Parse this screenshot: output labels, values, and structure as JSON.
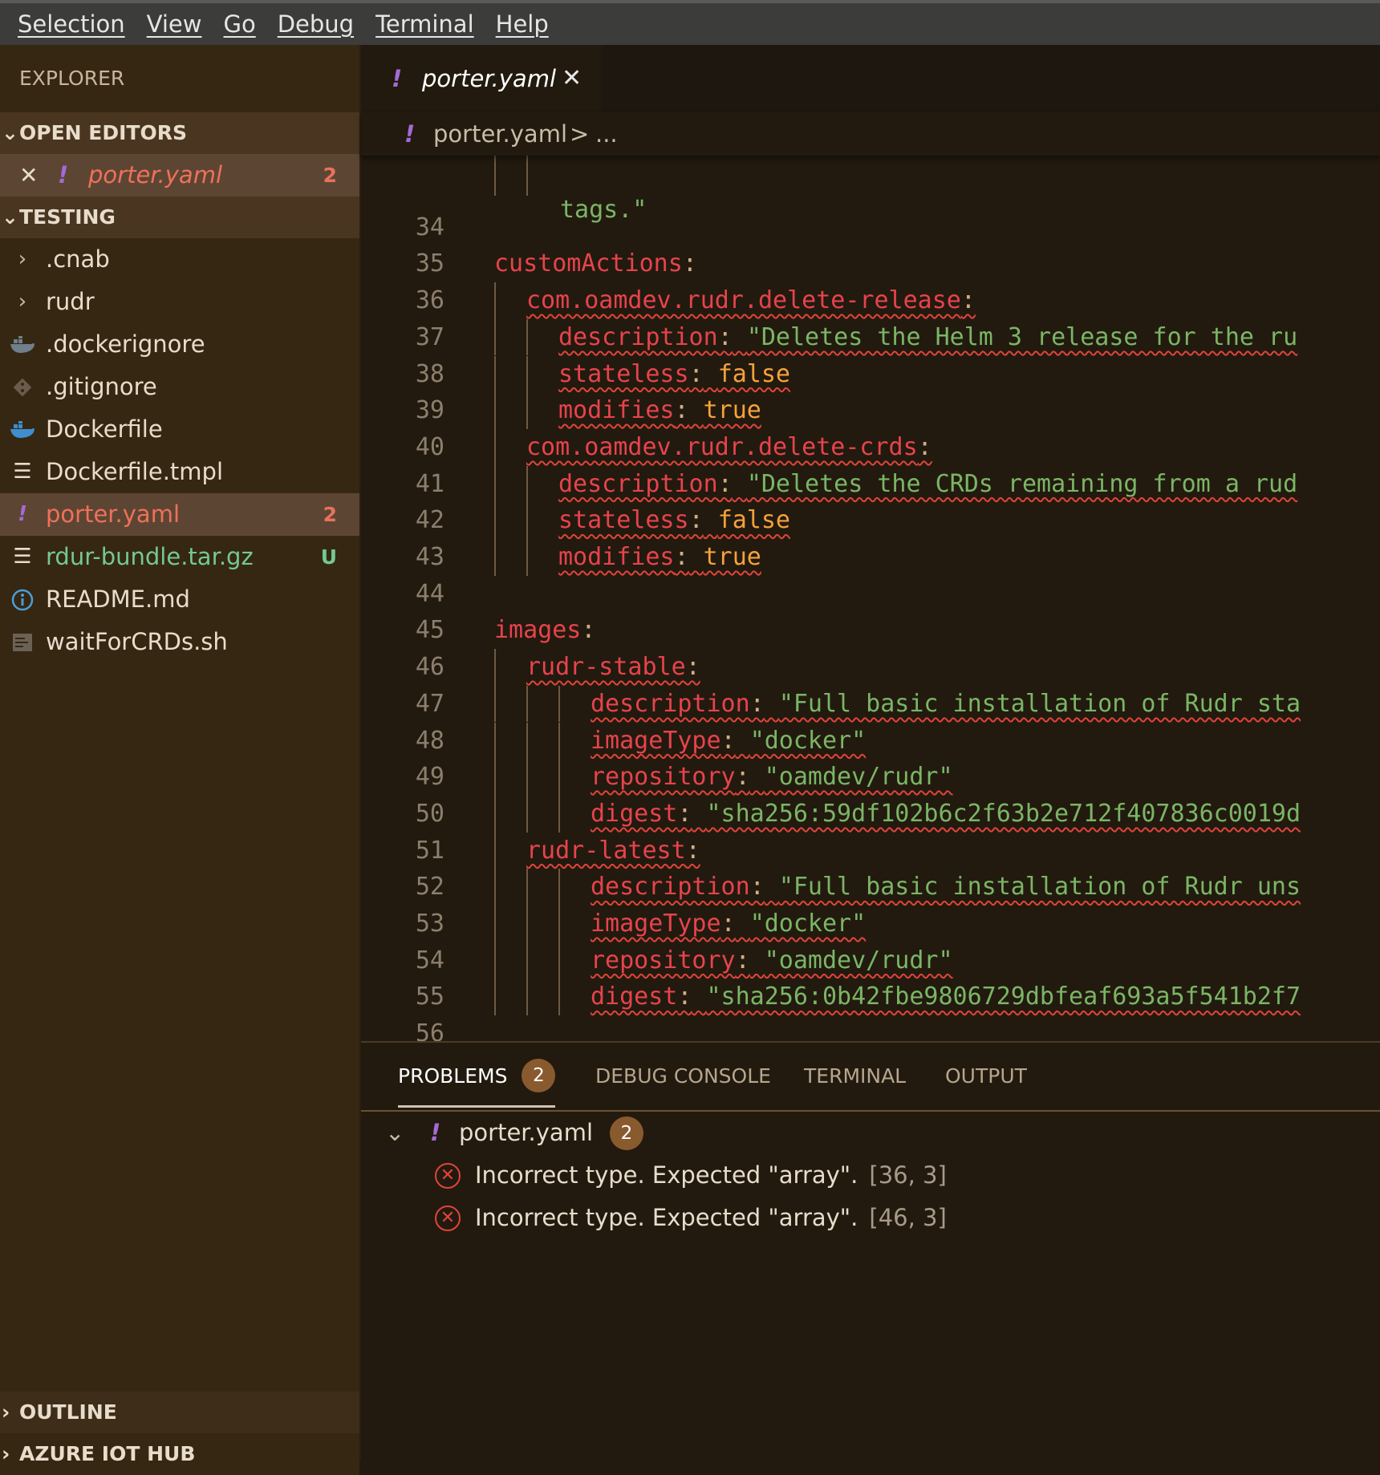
{
  "menu": [
    "Selection",
    "View",
    "Go",
    "Debug",
    "Terminal",
    "Help"
  ],
  "sidebar": {
    "title": "EXPLORER",
    "open_editors": {
      "header": "OPEN EDITORS",
      "items": [
        {
          "name": "porter.yaml",
          "badge": "2"
        }
      ]
    },
    "folder": {
      "header": "TESTING",
      "items": [
        {
          "name": ".cnab",
          "icon": "chevron-right-icon",
          "badge": ""
        },
        {
          "name": "rudr",
          "icon": "chevron-right-icon",
          "badge": ""
        },
        {
          "name": ".dockerignore",
          "icon": "docker-icon",
          "badge": ""
        },
        {
          "name": ".gitignore",
          "icon": "git-icon",
          "badge": ""
        },
        {
          "name": "Dockerfile",
          "icon": "docker-icon",
          "badge": ""
        },
        {
          "name": "Dockerfile.tmpl",
          "icon": "lines-icon",
          "badge": ""
        },
        {
          "name": "porter.yaml",
          "icon": "yaml-icon",
          "badge": "2"
        },
        {
          "name": "rdur-bundle.tar.gz",
          "icon": "lines-icon",
          "badge": "U"
        },
        {
          "name": "README.md",
          "icon": "info-icon",
          "badge": ""
        },
        {
          "name": "waitForCRDs.sh",
          "icon": "shell-icon",
          "badge": ""
        }
      ]
    },
    "outline_header": "OUTLINE",
    "azure_header": "AZURE IOT HUB"
  },
  "editor": {
    "tab_label": "porter.yaml",
    "breadcrumb": {
      "file": "porter.yaml",
      "separator": ">",
      "more": "..."
    },
    "first_fragment": "tags.\"",
    "lines": [
      {
        "n": "34",
        "text": ""
      },
      {
        "n": "35",
        "text": "customActions:"
      },
      {
        "n": "36",
        "text": "com.oamdev.rudr.delete-release:"
      },
      {
        "n": "37",
        "text": "description: \"Deletes the Helm 3 release for the ru"
      },
      {
        "n": "38",
        "text": "stateless: false"
      },
      {
        "n": "39",
        "text": "modifies: true"
      },
      {
        "n": "40",
        "text": "com.oamdev.rudr.delete-crds:"
      },
      {
        "n": "41",
        "text": "description: \"Deletes the CRDs remaining from a rud"
      },
      {
        "n": "42",
        "text": "stateless: false"
      },
      {
        "n": "43",
        "text": "modifies: true"
      },
      {
        "n": "44",
        "text": ""
      },
      {
        "n": "45",
        "text": "images:"
      },
      {
        "n": "46",
        "text": "rudr-stable:"
      },
      {
        "n": "47",
        "text": "description: \"Full basic installation of Rudr sta"
      },
      {
        "n": "48",
        "text": "imageType: \"docker\""
      },
      {
        "n": "49",
        "text": "repository: \"oamdev/rudr\""
      },
      {
        "n": "50",
        "text": "digest: \"sha256:59df102b6c2f63b2e712f407836c0019d"
      },
      {
        "n": "51",
        "text": "rudr-latest:"
      },
      {
        "n": "52",
        "text": "description: \"Full basic installation of Rudr uns"
      },
      {
        "n": "53",
        "text": "imageType: \"docker\""
      },
      {
        "n": "54",
        "text": "repository: \"oamdev/rudr\""
      },
      {
        "n": "55",
        "text": "digest: \"sha256:0b42fbe9806729dbfeaf693a5f541b2f7"
      },
      {
        "n": "56",
        "text": ""
      }
    ]
  },
  "panel": {
    "tabs": [
      "PROBLEMS",
      "DEBUG CONSOLE",
      "TERMINAL",
      "OUTPUT"
    ],
    "problems_count": "2",
    "file": {
      "name": "porter.yaml",
      "count": "2"
    },
    "problems": [
      {
        "message": "Incorrect type. Expected \"array\".",
        "position": "[36, 3]"
      },
      {
        "message": "Incorrect type. Expected \"array\".",
        "position": "[46, 3]"
      }
    ]
  },
  "colors": {
    "key": "#e7434c",
    "string": "#7bb565",
    "boolean": "#f7a13b",
    "error": "#e0443b",
    "badge": "#8a5a2f"
  }
}
